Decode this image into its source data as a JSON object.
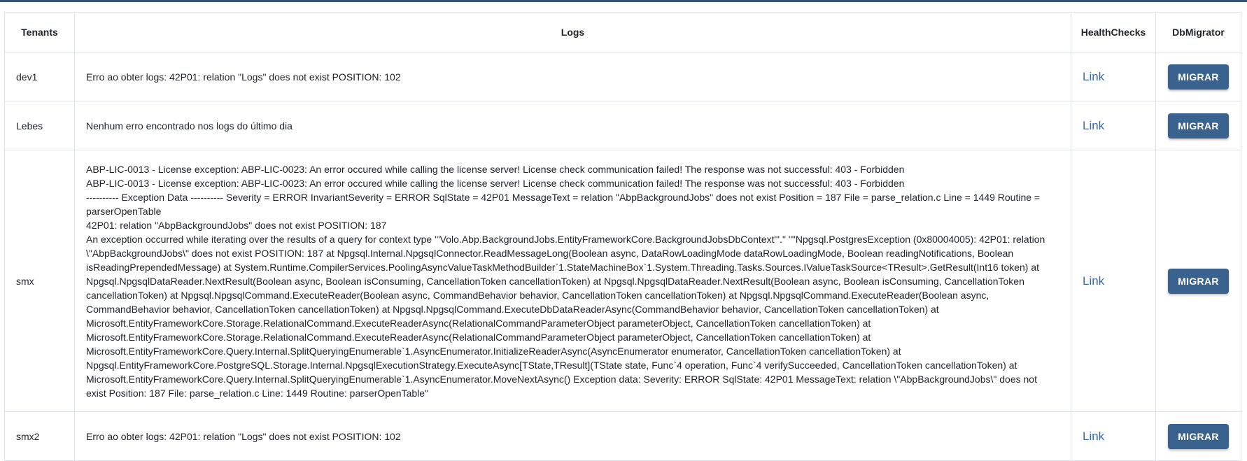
{
  "table": {
    "headers": [
      "Tenants",
      "Logs",
      "HealthChecks",
      "DbMigrator"
    ],
    "rows": [
      {
        "tenant": "dev1",
        "logs": [
          "Erro ao obter logs: 42P01: relation \"Logs\" does not exist POSITION: 102"
        ],
        "health": "Link",
        "action": "MIGRAR"
      },
      {
        "tenant": "Lebes",
        "logs": [
          "Nenhum erro encontrado nos logs do último dia"
        ],
        "health": "Link",
        "action": "MIGRAR"
      },
      {
        "tenant": "smx",
        "logs": [
          "ABP-LIC-0013 - License exception: ABP-LIC-0023: An error occured while calling the license server! License check communication failed! The response was not successful: 403 - Forbidden",
          "ABP-LIC-0013 - License exception: ABP-LIC-0023: An error occured while calling the license server! License check communication failed! The response was not successful: 403 - Forbidden",
          "---------- Exception Data ---------- Severity = ERROR InvariantSeverity = ERROR SqlState = 42P01 MessageText = relation \"AbpBackgroundJobs\" does not exist Position = 187 File = parse_relation.c Line = 1449 Routine = parserOpenTable",
          "42P01: relation \"AbpBackgroundJobs\" does not exist POSITION: 187",
          "An exception occurred while iterating over the results of a query for context type '\"Volo.Abp.BackgroundJobs.EntityFrameworkCore.BackgroundJobsDbContext\"'.\" \"\"Npgsql.PostgresException (0x80004005): 42P01: relation \\\"AbpBackgroundJobs\\\" does not exist POSITION: 187 at Npgsql.Internal.NpgsqlConnector.ReadMessageLong(Boolean async, DataRowLoadingMode dataRowLoadingMode, Boolean readingNotifications, Boolean isReadingPrependedMessage) at System.Runtime.CompilerServices.PoolingAsyncValueTaskMethodBuilder`1.StateMachineBox`1.System.Threading.Tasks.Sources.IValueTaskSource<TResult>.GetResult(Int16 token) at Npgsql.NpgsqlDataReader.NextResult(Boolean async, Boolean isConsuming, CancellationToken cancellationToken) at Npgsql.NpgsqlDataReader.NextResult(Boolean async, Boolean isConsuming, CancellationToken cancellationToken) at Npgsql.NpgsqlCommand.ExecuteReader(Boolean async, CommandBehavior behavior, CancellationToken cancellationToken) at Npgsql.NpgsqlCommand.ExecuteReader(Boolean async, CommandBehavior behavior, CancellationToken cancellationToken) at Npgsql.NpgsqlCommand.ExecuteDbDataReaderAsync(CommandBehavior behavior, CancellationToken cancellationToken) at Microsoft.EntityFrameworkCore.Storage.RelationalCommand.ExecuteReaderAsync(RelationalCommandParameterObject parameterObject, CancellationToken cancellationToken) at Microsoft.EntityFrameworkCore.Storage.RelationalCommand.ExecuteReaderAsync(RelationalCommandParameterObject parameterObject, CancellationToken cancellationToken) at Microsoft.EntityFrameworkCore.Query.Internal.SplitQueryingEnumerable`1.AsyncEnumerator.InitializeReaderAsync(AsyncEnumerator enumerator, CancellationToken cancellationToken) at Npgsql.EntityFrameworkCore.PostgreSQL.Storage.Internal.NpgsqlExecutionStrategy.ExecuteAsync[TState,TResult](TState state, Func`4 operation, Func`4 verifySucceeded, CancellationToken cancellationToken) at Microsoft.EntityFrameworkCore.Query.Internal.SplitQueryingEnumerable`1.AsyncEnumerator.MoveNextAsync() Exception data: Severity: ERROR SqlState: 42P01 MessageText: relation \\\"AbpBackgroundJobs\\\" does not exist Position: 187 File: parse_relation.c Line: 1449 Routine: parserOpenTable\""
        ],
        "health": "Link",
        "action": "MIGRAR"
      },
      {
        "tenant": "smx2",
        "logs": [
          "Erro ao obter logs: 42P01: relation \"Logs\" does not exist POSITION: 102"
        ],
        "health": "Link",
        "action": "MIGRAR"
      }
    ]
  }
}
